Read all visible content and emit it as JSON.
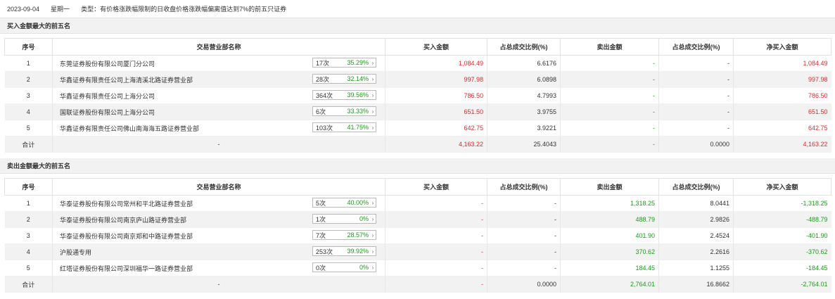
{
  "header": {
    "date": "2023-09-04",
    "weekday": "星期一",
    "type_label": "类型：",
    "type_desc": "有价格涨跌幅限制的日收盘价格涨跌幅偏离值达到7%的前五只证券"
  },
  "columns": [
    "序号",
    "交易营业部名称",
    "买入金额",
    "占总成交比例(%)",
    "卖出金额",
    "占总成交比例(%)",
    "净买入金额"
  ],
  "buy_section": {
    "title": "买入金额最大的前五名",
    "rows": [
      {
        "idx": "1",
        "name": "东莞证券股份有限公司厦门分公司",
        "count": "17次",
        "pct": "35.29%",
        "buy": "1,084.49",
        "buy_ratio": "6.6176",
        "sell": "-",
        "sell_ratio": "-",
        "net": "1,084.49"
      },
      {
        "idx": "2",
        "name": "华鑫证券有限责任公司上海清溪北路证券营业部",
        "count": "28次",
        "pct": "32.14%",
        "buy": "997.98",
        "buy_ratio": "6.0898",
        "sell": "-",
        "sell_ratio": "-",
        "net": "997.98"
      },
      {
        "idx": "3",
        "name": "华鑫证券有限责任公司上海分公司",
        "count": "364次",
        "pct": "39.56%",
        "buy": "786.50",
        "buy_ratio": "4.7993",
        "sell": "-",
        "sell_ratio": "-",
        "net": "786.50"
      },
      {
        "idx": "4",
        "name": "国联证券股份有限公司上海分公司",
        "count": "6次",
        "pct": "33.33%",
        "buy": "651.50",
        "buy_ratio": "3.9755",
        "sell": "-",
        "sell_ratio": "-",
        "net": "651.50"
      },
      {
        "idx": "5",
        "name": "华鑫证券有限责任公司佛山南海海五路证券营业部",
        "count": "103次",
        "pct": "41.75%",
        "buy": "642.75",
        "buy_ratio": "3.9221",
        "sell": "-",
        "sell_ratio": "-",
        "net": "642.75"
      }
    ],
    "total": {
      "label": "合计",
      "name": "-",
      "buy": "4,163.22",
      "buy_ratio": "25.4043",
      "sell": "-",
      "sell_ratio": "0.0000",
      "net": "4,163.22"
    }
  },
  "sell_section": {
    "title": "卖出金额最大的前五名",
    "rows": [
      {
        "idx": "1",
        "name": "华泰证券股份有限公司常州和平北路证券营业部",
        "count": "5次",
        "pct": "40.00%",
        "buy": "-",
        "buy_ratio": "-",
        "sell": "1,318.25",
        "sell_ratio": "8.0441",
        "net": "-1,318.25"
      },
      {
        "idx": "2",
        "name": "华泰证券股份有限公司南京庐山路证券营业部",
        "count": "1次",
        "pct": "0%",
        "buy": "-",
        "buy_ratio": "-",
        "sell": "488.79",
        "sell_ratio": "2.9826",
        "net": "-488.79"
      },
      {
        "idx": "3",
        "name": "华泰证券股份有限公司南京郑和中路证券营业部",
        "count": "7次",
        "pct": "28.57%",
        "buy": "-",
        "buy_ratio": "-",
        "sell": "401.90",
        "sell_ratio": "2.4524",
        "net": "-401.90"
      },
      {
        "idx": "4",
        "name": "沪股通专用",
        "count": "253次",
        "pct": "39.92%",
        "buy": "-",
        "buy_ratio": "-",
        "sell": "370.62",
        "sell_ratio": "2.2616",
        "net": "-370.62"
      },
      {
        "idx": "5",
        "name": "红塔证券股份有限公司深圳福华一路证券营业部",
        "count": "0次",
        "pct": "0%",
        "buy": "-",
        "buy_ratio": "-",
        "sell": "184.45",
        "sell_ratio": "1.1255",
        "net": "-184.45"
      }
    ],
    "total": {
      "label": "合计",
      "name": "-",
      "buy": "-",
      "buy_ratio": "0.0000",
      "sell": "2,764.01",
      "sell_ratio": "16.8662",
      "net": "-2,764.01"
    }
  },
  "icons": {
    "expand": "chevron-right-icon"
  },
  "colors": {
    "buy": "#e12b2b",
    "sell": "#1a9c1a",
    "stripe": "#f2f2f2"
  }
}
